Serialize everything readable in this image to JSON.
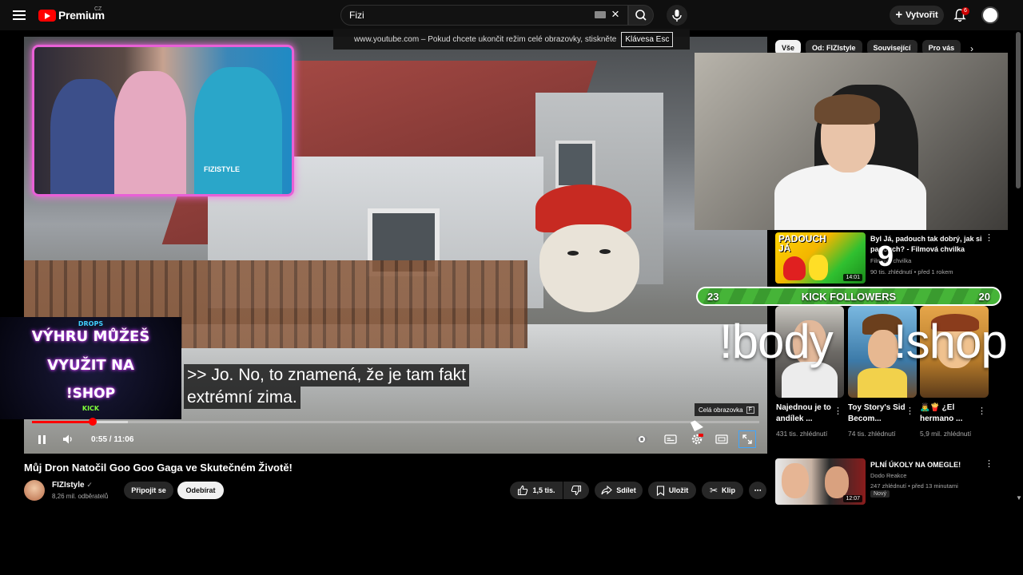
{
  "header": {
    "logo_text": "Premium",
    "region": "CZ",
    "search_value": "Fizi",
    "create_label": "Vytvořit",
    "notification_count": "6"
  },
  "fullscreen_notice": {
    "text": "www.youtube.com – Pokud chcete ukončit režim celé obrazovky, stiskněte",
    "key": "Klávesa Esc"
  },
  "player": {
    "promo": {
      "top_small": "DROPS",
      "line1": "VÝHRU MŮŽEŠ",
      "line2": "VYUŽIT NA",
      "line3": "!SHOP",
      "bottom_small": "KICK"
    },
    "webcam_shirt_text": "FIZISTYLE",
    "captions": [
      ">> Jo. No, to znamená, že je tam fakt",
      "extrémní zima."
    ],
    "tooltip": {
      "label": "Celá obrazovka",
      "key": "F"
    },
    "time_display": "0:55 / 11:06",
    "progress": 0.083,
    "controls": {
      "autoplay": "autoplay-toggle-icon",
      "subtitles": "subtitles-icon",
      "settings": "settings-gear-icon",
      "theater": "theater-mode-icon",
      "fullscreen": "exit-fullscreen-icon"
    }
  },
  "video_info": {
    "title": "Můj Dron Natočil Goo Goo Gaga ve Skutečném Životě!",
    "channel_name": "FIZIstyle",
    "subscribers": "8,26 mil. odběratelů",
    "join_label": "Připojit se",
    "subscribe_label": "Odebírat",
    "likes": "1,5 tis.",
    "share_label": "Sdílet",
    "save_label": "Uložit",
    "clip_label": "Klip",
    "more_label": "⋯"
  },
  "sidebar": {
    "chips": [
      "Vše",
      "Od: FIZIstyle",
      "Související",
      "Pro vás"
    ],
    "recommendations": [
      {
        "title": "Byl Já, padouch tak dobrý, jak si padouch? - Filmová chvilka",
        "channel": "Filmová chvilka",
        "meta": "90 tis. zhlédnutí • před 1 rokem",
        "duration": "14:01",
        "thumb_text": "PADOUCH JÁ"
      },
      {
        "title": "PLNÍ ÚKOLY NA OMEGLE!",
        "channel": "Dodo Reakce",
        "meta": "247 zhlédnutí • před 13 minutami",
        "duration": "12:07",
        "badge": "Nový"
      }
    ],
    "shorts": [
      {
        "title": "Najednou je to andílek ...",
        "views": "431 tis. zhlédnutí"
      },
      {
        "title": "Toy Story's Sid Becom...",
        "views": "74 tis. zhlédnutí"
      },
      {
        "title": "🙇‍♂️🍟 ¿El hermano ...",
        "views": "5,9 mil. zhlédnutí"
      }
    ]
  },
  "stream_overlay": {
    "kick_left": "23",
    "kick_label": "KICK FOLLOWERS",
    "kick_right": "20",
    "cmd1": "!body",
    "cmd2": "!shop",
    "big_number": "9"
  }
}
